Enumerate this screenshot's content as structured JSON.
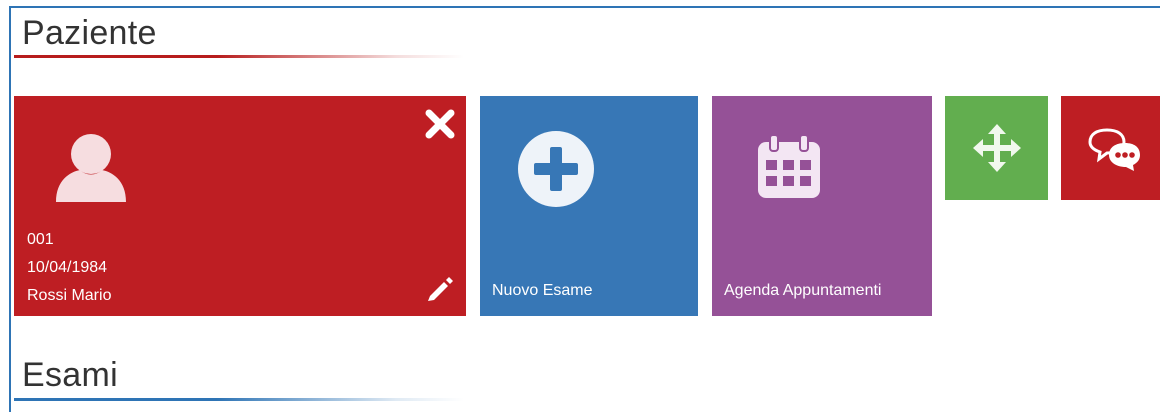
{
  "sections": {
    "paziente_title": "Paziente",
    "esami_title": "Esami"
  },
  "patient_card": {
    "code": "001",
    "birth_date": "10/04/1984",
    "name": "Rossi Mario"
  },
  "tiles": {
    "new_exam_label": "Nuovo Esame",
    "agenda_label": "Agenda Appuntamenti"
  },
  "colors": {
    "patient_tile": "#be1e23",
    "new_exam_tile": "#3777b6",
    "agenda_tile": "#955197",
    "move_tile": "#62ae4f",
    "chat_tile": "#be1e23",
    "paziente_rule": "#b71c1c",
    "esami_rule": "#2e74b5"
  },
  "icons": {
    "patient": "user-icon",
    "close": "close-icon",
    "edit": "pencil-icon",
    "new_exam": "plus-circle-icon",
    "agenda": "calendar-icon",
    "move": "arrows-move-icon",
    "chat": "chat-bubbles-icon"
  }
}
